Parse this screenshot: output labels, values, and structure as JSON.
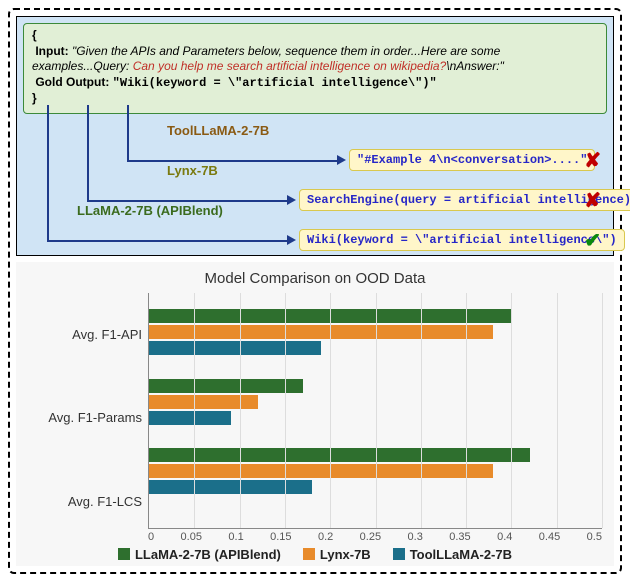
{
  "prompt": {
    "brace_open": "{",
    "brace_close": "}",
    "input_label": "Input:",
    "input_prefix": "\"Given the APIs and Parameters below, sequence them in order...Here are some examples...Query: ",
    "input_query": "Can you help me search artificial intelligence on wikipedia?",
    "input_suffix": "\\nAnswer:\"",
    "gold_label": "Gold Output:",
    "gold_output": "\"Wiki(keyword = \\\"artificial intelligence\\\")\""
  },
  "models": [
    {
      "name": "ToolLLaMA-2-7B",
      "output": "\"#Example 4\\n<conversation>....\"",
      "mark": "✘",
      "correct": false
    },
    {
      "name": "Lynx-7B",
      "output": "SearchEngine(query = artificial intelligence)",
      "mark": "✘",
      "correct": false
    },
    {
      "name": "LLaMA-2-7B (APIBlend)",
      "output": "Wiki(keyword = \\\"artificial intelligence\\\")",
      "mark": "✔",
      "correct": true
    }
  ],
  "chart_data": {
    "type": "bar",
    "orientation": "horizontal",
    "title": "Model Comparison on OOD Data",
    "xlabel": "",
    "ylabel": "",
    "xlim": [
      0,
      0.5
    ],
    "xticks": [
      0,
      0.05,
      0.1,
      0.15,
      0.2,
      0.25,
      0.3,
      0.35,
      0.4,
      0.45,
      0.5
    ],
    "categories": [
      "Avg. F1-API",
      "Avg. F1-Params",
      "Avg. F1-LCS"
    ],
    "series": [
      {
        "name": "LLaMA-2-7B (APIBlend)",
        "color": "#2e6f2e",
        "values": [
          0.4,
          0.17,
          0.42
        ]
      },
      {
        "name": "Lynx-7B",
        "color": "#e88b2b",
        "values": [
          0.38,
          0.12,
          0.38
        ]
      },
      {
        "name": "ToolLLaMA-2-7B",
        "color": "#1b6f8a",
        "values": [
          0.19,
          0.09,
          0.18
        ]
      }
    ]
  }
}
